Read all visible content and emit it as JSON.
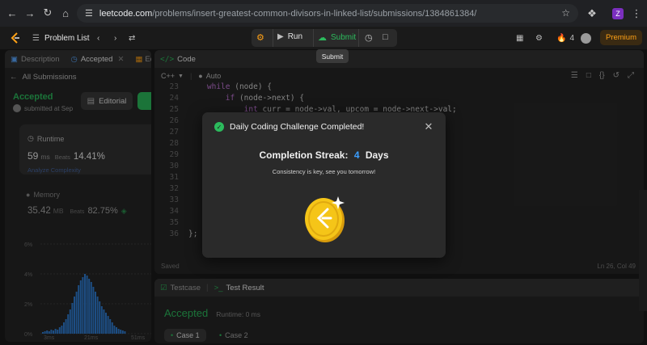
{
  "browser": {
    "host": "leetcode.com",
    "path": "/problems/insert-greatest-common-divisors-in-linked-list/submissions/1384861384/"
  },
  "header": {
    "problem_list": "Problem List",
    "run": "Run",
    "submit": "Submit",
    "streak_count": "4",
    "premium": "Premium",
    "tooltip": "Submit"
  },
  "left_panel": {
    "tabs": [
      {
        "label": "Description"
      },
      {
        "label": "Accepted"
      },
      {
        "label": "Ed"
      }
    ],
    "all_submissions": "All Submissions",
    "status": "Accepted",
    "submitted_at": "submitted at Sep",
    "editorial_label": "Editorial",
    "runtime": {
      "title": "Runtime",
      "value": "59",
      "unit": "ms",
      "beats_label": "Beats",
      "beats": "14.41%",
      "analyze": "Analyze Complexity"
    },
    "memory": {
      "title": "Memory",
      "value": "35.42",
      "unit": "MB",
      "beats_label": "Beats",
      "beats": "82.75%"
    },
    "histogram": {
      "y_labels": [
        "6%",
        "4%",
        "2%",
        "0%"
      ],
      "x_labels": [
        "3ms",
        "21ms",
        "51ms"
      ]
    }
  },
  "code_panel": {
    "title": "Code",
    "language": "C++",
    "auto": "Auto",
    "status": "Saved",
    "cursor": "Ln 26, Col 49",
    "lines": [
      {
        "n": "23",
        "pre": "    ",
        "kw": "while",
        "rest": " (node) {"
      },
      {
        "n": "24",
        "pre": "        ",
        "kw": "if",
        "rest": " (node->next) {"
      },
      {
        "n": "25",
        "pre": "            ",
        "kw": "int",
        "rest": " curr = node->val, upcom = node->next->val;"
      },
      {
        "n": "26",
        "pre": "",
        "kw": "",
        "rest": ""
      },
      {
        "n": "27",
        "pre": "",
        "kw": "",
        "rest": "                                                com));"
      },
      {
        "n": "28",
        "pre": "",
        "kw": "",
        "rest": ""
      },
      {
        "n": "29",
        "pre": "",
        "kw": "",
        "rest": ""
      },
      {
        "n": "30",
        "pre": "",
        "kw": "",
        "rest": ""
      },
      {
        "n": "31",
        "pre": "",
        "kw": "",
        "rest": ""
      },
      {
        "n": "32",
        "pre": "",
        "kw": "",
        "rest": ""
      },
      {
        "n": "33",
        "pre": "",
        "kw": "",
        "rest": ""
      },
      {
        "n": "34",
        "pre": "",
        "kw": "",
        "rest": ""
      },
      {
        "n": "35",
        "pre": "",
        "kw": "",
        "rest": ""
      },
      {
        "n": "36",
        "pre": "",
        "kw": "",
        "rest": "};"
      }
    ]
  },
  "result_panel": {
    "tabs": [
      {
        "label": "Testcase"
      },
      {
        "label": "Test Result"
      }
    ],
    "status": "Accepted",
    "runtime": "Runtime: 0 ms",
    "cases": [
      {
        "label": "Case 1"
      },
      {
        "label": "Case 2"
      }
    ]
  },
  "modal": {
    "title": "Daily Coding Challenge Completed!",
    "streak_label": "Completion Streak:",
    "streak_value": "4",
    "streak_unit": "Days",
    "message": "Consistency is key, see you tomorrow!"
  },
  "colors": {
    "accepted": "#2cbb5d",
    "accent_blue": "#3b9eff",
    "coin": "#f5c518",
    "submit_green": "#2cbb5d",
    "streak_orange": "#ff9b2e"
  }
}
